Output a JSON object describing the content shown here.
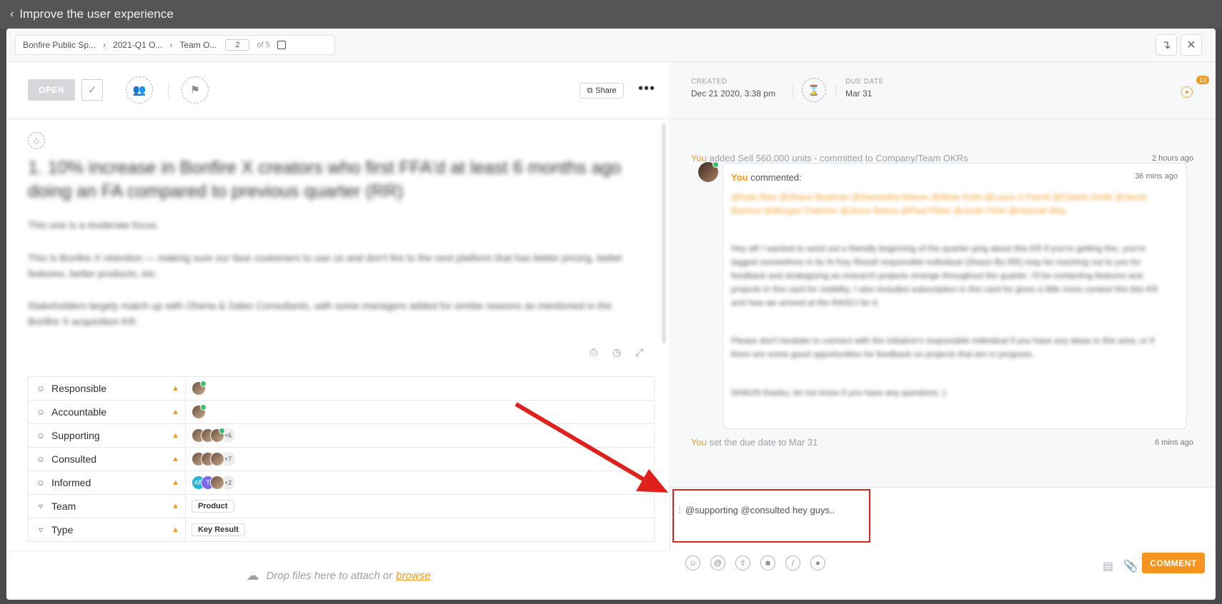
{
  "window": {
    "back_label": "Improve the user experience"
  },
  "breadcrumb": {
    "items": [
      "Bonfire Public Sp...",
      "2021-Q1 O...",
      "Team O..."
    ],
    "page_current": "2",
    "page_total": "of 5"
  },
  "toolbar": {
    "status": "OPEN",
    "share_label": "Share",
    "more_label": "•••"
  },
  "task": {
    "title": "1. 10% increase in Bonfire X creators who first FFA'd at least 6 months ago doing an FA compared to previous quarter (RR)",
    "paragraphs": [
      "This one is a moderate focus.",
      "This is Bonfire X retention — making sure our fave customers to use us and don't fire to the next platform that has better pricing, better features, better products, etc.",
      "Stakeholders largely match up with Ohena & Sales Consultants, with some managers added for similar reasons as mentioned in the Bonfire X acquisition KR."
    ]
  },
  "fields": [
    {
      "name": "Responsible",
      "icon": "person-icon",
      "type": "avatars"
    },
    {
      "name": "Accountable",
      "icon": "person-icon",
      "type": "avatars"
    },
    {
      "name": "Supporting",
      "icon": "person-icon",
      "type": "avatars",
      "extra": "+6"
    },
    {
      "name": "Consulted",
      "icon": "person-icon",
      "type": "avatars",
      "extra": "+7"
    },
    {
      "name": "Informed",
      "icon": "person-icon",
      "type": "avatars",
      "extra": "+2",
      "initials": [
        "AR",
        "T"
      ]
    },
    {
      "name": "Team",
      "icon": "dropdown-icon",
      "type": "chip",
      "value": "Product"
    },
    {
      "name": "Type",
      "icon": "dropdown-icon",
      "type": "chip",
      "value": "Key Result"
    }
  ],
  "dropzone": {
    "text": "Drop files here to attach or",
    "link": "browse"
  },
  "meta": {
    "created_label": "CREATED",
    "created_value": "Dec 21 2020, 3:38 pm",
    "due_label": "DUE DATE",
    "due_value": "Mar 31",
    "watchers": "13"
  },
  "activity": [
    {
      "actor": "You",
      "text": "added Sell 560,000 units - committed to Company/Team OKRs",
      "time": "2 hours ago"
    },
    {
      "actor": "You",
      "text": "set the due date to Mar 31",
      "time": "6 mins ago"
    }
  ],
  "comment": {
    "actor": "You",
    "verb": "commented:",
    "time": "36 mins ago",
    "mentions": "@Kate Blair @Shaun Boatman @Samantha Nelson @Nihar Kotni @Laura S Farrell @Charlie Smith @Jacob Barbour @Morgan Thatcher @Jesse Bartos @Paul Pilder @Justin Fleet @Hannah May",
    "body1": "Hey all! I wanted to send out a friendly beginning of the quarter ping about this KR if you're getting this, you're tagged somewhere in its % Key Result responsible individual (Shaun Bo RR) may be reaching out to you for feedback and strategizing as research projects emerge throughout the quarter. I'll be contacting features and projects in this card for visibility; I also included subscription in this card for gives a little more context this this KR and how we arrived at the RASCI for it.",
    "body2": "Please don't hesitate to connect with the initiative's responsible individual if you have any ideas in this area, or if there are some good opportunities for feedback on projects that are in progress.",
    "body3": "SHAUN thanks; let me know if you have any questions :)"
  },
  "composer": {
    "text": "@supporting @consulted hey guys..",
    "submit_label": "COMMENT"
  },
  "colors": {
    "accent": "#f7941d",
    "annotation": "#e0201b"
  }
}
